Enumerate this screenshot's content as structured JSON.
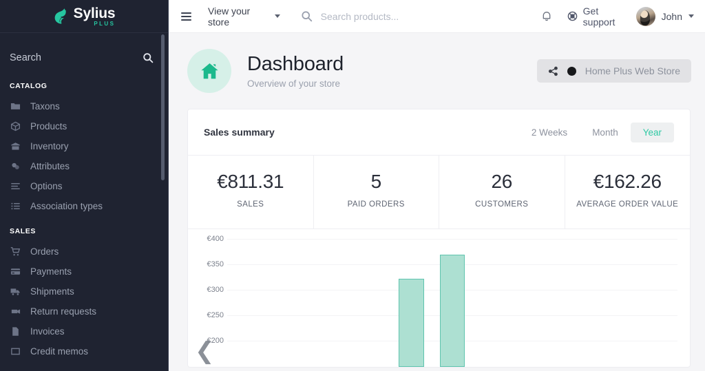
{
  "sidebar": {
    "brand": {
      "name": "Sylius",
      "sub": "PLUS",
      "logo_icon": "swan-logo-icon"
    },
    "search": {
      "placeholder": "Search",
      "value": "",
      "icon": "search-icon"
    },
    "sections": [
      {
        "label": "CATALOG",
        "items": [
          {
            "label": "Taxons",
            "icon": "folder-icon"
          },
          {
            "label": "Products",
            "icon": "box-icon"
          },
          {
            "label": "Inventory",
            "icon": "warehouse-icon"
          },
          {
            "label": "Attributes",
            "icon": "layers-icon"
          },
          {
            "label": "Options",
            "icon": "sliders-icon"
          },
          {
            "label": "Association types",
            "icon": "list-icon"
          }
        ]
      },
      {
        "label": "SALES",
        "items": [
          {
            "label": "Orders",
            "icon": "cart-icon"
          },
          {
            "label": "Payments",
            "icon": "credit-card-icon"
          },
          {
            "label": "Shipments",
            "icon": "truck-icon"
          },
          {
            "label": "Return requests",
            "icon": "return-icon"
          },
          {
            "label": "Invoices",
            "icon": "file-icon"
          },
          {
            "label": "Credit memos",
            "icon": "receipt-icon"
          }
        ]
      }
    ]
  },
  "topbar": {
    "menu_icon": "hamburger-icon",
    "store_link": "View your store",
    "store_caret_icon": "chevron-down-icon",
    "search": {
      "placeholder": "Search products...",
      "value": "",
      "icon": "search-icon"
    },
    "notifications_icon": "bell-icon",
    "support": {
      "label": "Get support",
      "icon": "lifebuoy-icon"
    },
    "user": {
      "name": "John",
      "avatar_icon": "avatar",
      "caret_icon": "chevron-down-icon"
    }
  },
  "page": {
    "icon": "home-icon",
    "title": "Dashboard",
    "subtitle": "Overview of your store",
    "store_chip": {
      "label": "Home Plus Web Store",
      "share_icon": "share-icon",
      "dot_icon": "status-dot-icon"
    }
  },
  "card": {
    "title": "Sales summary",
    "ranges": [
      {
        "label": "2 Weeks",
        "active": false
      },
      {
        "label": "Month",
        "active": false
      },
      {
        "label": "Year",
        "active": true
      }
    ],
    "stats": [
      {
        "value": "€811.31",
        "label": "SALES"
      },
      {
        "value": "5",
        "label": "PAID ORDERS"
      },
      {
        "value": "26",
        "label": "CUSTOMERS"
      },
      {
        "value": "€162.26",
        "label": "AVERAGE ORDER VALUE"
      }
    ],
    "prev_icon": "chevron-left-icon"
  },
  "colors": {
    "sidebar_bg": "#1f2331",
    "brand_accent": "#26c6a0",
    "tab_active_text": "#2fc9a4",
    "page_icon_bg": "#d6f0e8",
    "bar_fill": "#ade0d2",
    "bar_stroke": "#5ec4ae"
  },
  "chart_data": {
    "type": "bar",
    "title": "Sales summary",
    "xlabel": "",
    "ylabel": "",
    "ylim": [
      150,
      400
    ],
    "yticks": [
      400,
      350,
      300,
      250,
      200
    ],
    "ytick_labels": [
      "€400",
      "€350",
      "€300",
      "€250",
      "€200"
    ],
    "grid": true,
    "legend": "none",
    "currency": "EUR",
    "categories": [
      "",
      "",
      "",
      "",
      "",
      "",
      "",
      "",
      "",
      "",
      ""
    ],
    "values": [
      0,
      0,
      0,
      0,
      322,
      368,
      0,
      0,
      0,
      0,
      0
    ],
    "bars": [
      {
        "index": 4,
        "value": 322
      },
      {
        "index": 5,
        "value": 368
      }
    ]
  }
}
